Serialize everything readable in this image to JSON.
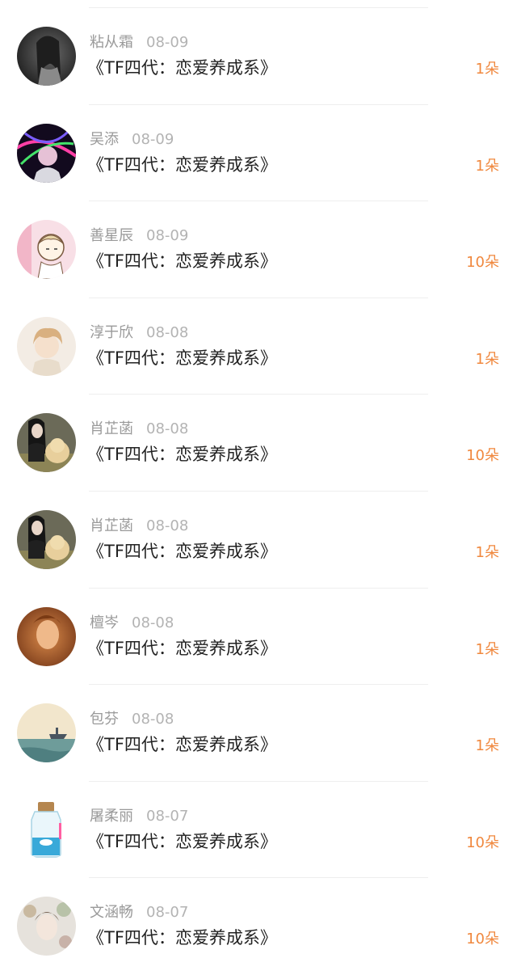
{
  "gift_list": [
    {
      "name": "粘从霜",
      "date": "08-09",
      "title": "《TF四代：恋爱养成系》",
      "amount": "1朵",
      "avatar": "dark-portrait"
    },
    {
      "name": "吴添",
      "date": "08-09",
      "title": "《TF四代：恋爱养成系》",
      "amount": "1朵",
      "avatar": "neon-light"
    },
    {
      "name": "善星辰",
      "date": "08-09",
      "title": "《TF四代：恋爱养成系》",
      "amount": "10朵",
      "avatar": "cartoon-girl"
    },
    {
      "name": "淳于欣",
      "date": "08-08",
      "title": "《TF四代：恋爱养成系》",
      "amount": "1朵",
      "avatar": "anime-boy"
    },
    {
      "name": "肖芷菡",
      "date": "08-08",
      "title": "《TF四代：恋爱养成系》",
      "amount": "10朵",
      "avatar": "girl-with-dog"
    },
    {
      "name": "肖芷菡",
      "date": "08-08",
      "title": "《TF四代：恋爱养成系》",
      "amount": "1朵",
      "avatar": "girl-with-dog"
    },
    {
      "name": "檀岑",
      "date": "08-08",
      "title": "《TF四代：恋爱养成系》",
      "amount": "1朵",
      "avatar": "warm-portrait"
    },
    {
      "name": "包芬",
      "date": "08-08",
      "title": "《TF四代：恋爱养成系》",
      "amount": "1朵",
      "avatar": "sea-ship"
    },
    {
      "name": "屠柔丽",
      "date": "08-07",
      "title": "《TF四代：恋爱养成系》",
      "amount": "10朵",
      "avatar": "whale-bottle"
    },
    {
      "name": "文涵畅",
      "date": "08-07",
      "title": "《TF四代：恋爱养成系》",
      "amount": "10朵",
      "avatar": "flower-girl"
    }
  ],
  "colors": {
    "amount": "#f0883e",
    "name": "#9a9a9a",
    "title": "#222222",
    "divider": "#eeeeee"
  }
}
